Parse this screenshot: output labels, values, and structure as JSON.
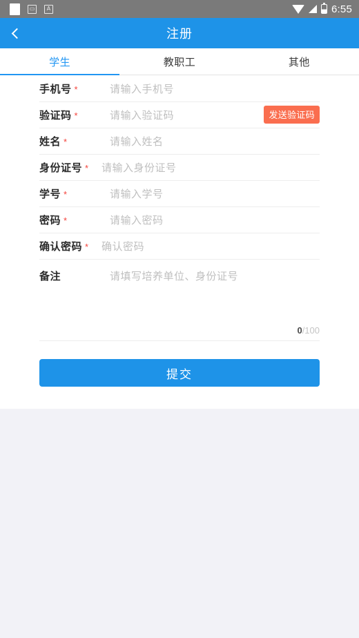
{
  "statusbar": {
    "time": "6:55",
    "icons_left": [
      "white-square-icon",
      "sd-card-icon",
      "font-size-icon"
    ],
    "icons_right": [
      "wifi-icon",
      "signal-icon",
      "battery-icon"
    ]
  },
  "appbar": {
    "title": "注册",
    "back_icon": "chevron-left-icon",
    "bg_color": "#1E93E8"
  },
  "tabs": {
    "active_index": 0,
    "accent_color": "#2196F3",
    "items": [
      {
        "label": "学生"
      },
      {
        "label": "教职工"
      },
      {
        "label": "其他"
      }
    ]
  },
  "form": {
    "required_mark": "*",
    "required_color": "#F4433C",
    "fields": [
      {
        "label": "手机号",
        "required": true,
        "placeholder": "请输入手机号",
        "value": ""
      },
      {
        "label": "验证码",
        "required": true,
        "placeholder": "请输入验证码",
        "value": ""
      },
      {
        "label": "姓名",
        "required": true,
        "placeholder": "请输入姓名",
        "value": ""
      },
      {
        "label": "身份证号",
        "required": true,
        "placeholder": "请输入身份证号",
        "value": ""
      },
      {
        "label": "学号",
        "required": true,
        "placeholder": "请输入学号",
        "value": ""
      },
      {
        "label": "密码",
        "required": true,
        "placeholder": "请输入密码",
        "value": ""
      },
      {
        "label": "确认密码",
        "required": true,
        "placeholder": "确认密码",
        "value": ""
      }
    ],
    "note": {
      "label": "备注",
      "required": false,
      "placeholder": "请填写培养单位、身份证号",
      "value": "",
      "count": "0",
      "limit": "/100"
    },
    "send_code_button": {
      "label": "发送验证码",
      "bg_color": "#FA6E4F"
    }
  },
  "submit": {
    "label": "提交",
    "bg_color": "#1E93E8"
  }
}
